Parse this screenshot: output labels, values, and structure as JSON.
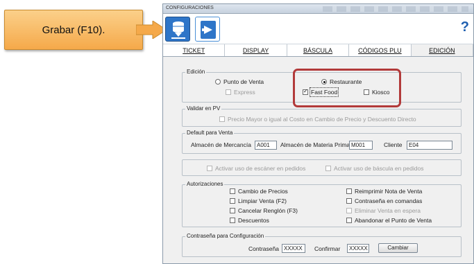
{
  "callout": {
    "text": "Grabar (F10)."
  },
  "window": {
    "title": "CONFIGURACIONES",
    "help_label": "?",
    "toolbar": [
      {
        "name": "save",
        "icon": "database-save-icon"
      },
      {
        "name": "exit",
        "icon": "exit-door-icon"
      }
    ]
  },
  "tabs": [
    "TICKET",
    "DISPLAY",
    "BÁSCULA",
    "CÓDIGOS PLU",
    "EDICIÓN"
  ],
  "active_tab": "EDICIÓN",
  "edicion": {
    "title": "Edición",
    "punto_venta": "Punto de Venta",
    "restaurante": "Restaurante",
    "express": "Express",
    "fast_food": "Fast Food",
    "kiosco": "Kiosco",
    "selected": "Restaurante",
    "fast_food_checked": true
  },
  "validar": {
    "title": "Validar en PV",
    "precio_mayor": "Precio Mayor o igual al Costo en Cambio de Precio y Descuento Directo"
  },
  "default_venta": {
    "title": "Default para Venta",
    "almacen_mercancia_label": "Almacén de Mercancía",
    "almacen_mercancia_value": "A001",
    "almacen_materia_label": "Almacén de Materia Prima",
    "almacen_materia_value": "M001",
    "cliente_label": "Cliente",
    "cliente_value": "E04"
  },
  "opciones": {
    "escaner": "Activar uso de escáner en pedidos",
    "bascula": "Activar uso de báscula en pedidos"
  },
  "autorizaciones": {
    "title": "Autorizaciones",
    "left": [
      "Cambio de Precios",
      "Limpiar Venta (F2)",
      "Cancelar Renglón (F3)",
      "Descuentos"
    ],
    "right": [
      "Reimprimir Nota de Venta",
      "Contraseña en comandas",
      "Eliminar Venta en espera",
      "Abandonar el Punto de Venta"
    ]
  },
  "contrasena": {
    "title": "Contraseña para Configuración",
    "password_label": "Contraseña",
    "password_value": "XXXXX",
    "confirm_label": "Confirmar",
    "confirm_value": "XXXXX",
    "change_label": "Cambiar"
  },
  "colors": {
    "callout": "#f5a94a",
    "highlight": "#b23a3a",
    "toolbar_blue": "#2e75c8"
  }
}
